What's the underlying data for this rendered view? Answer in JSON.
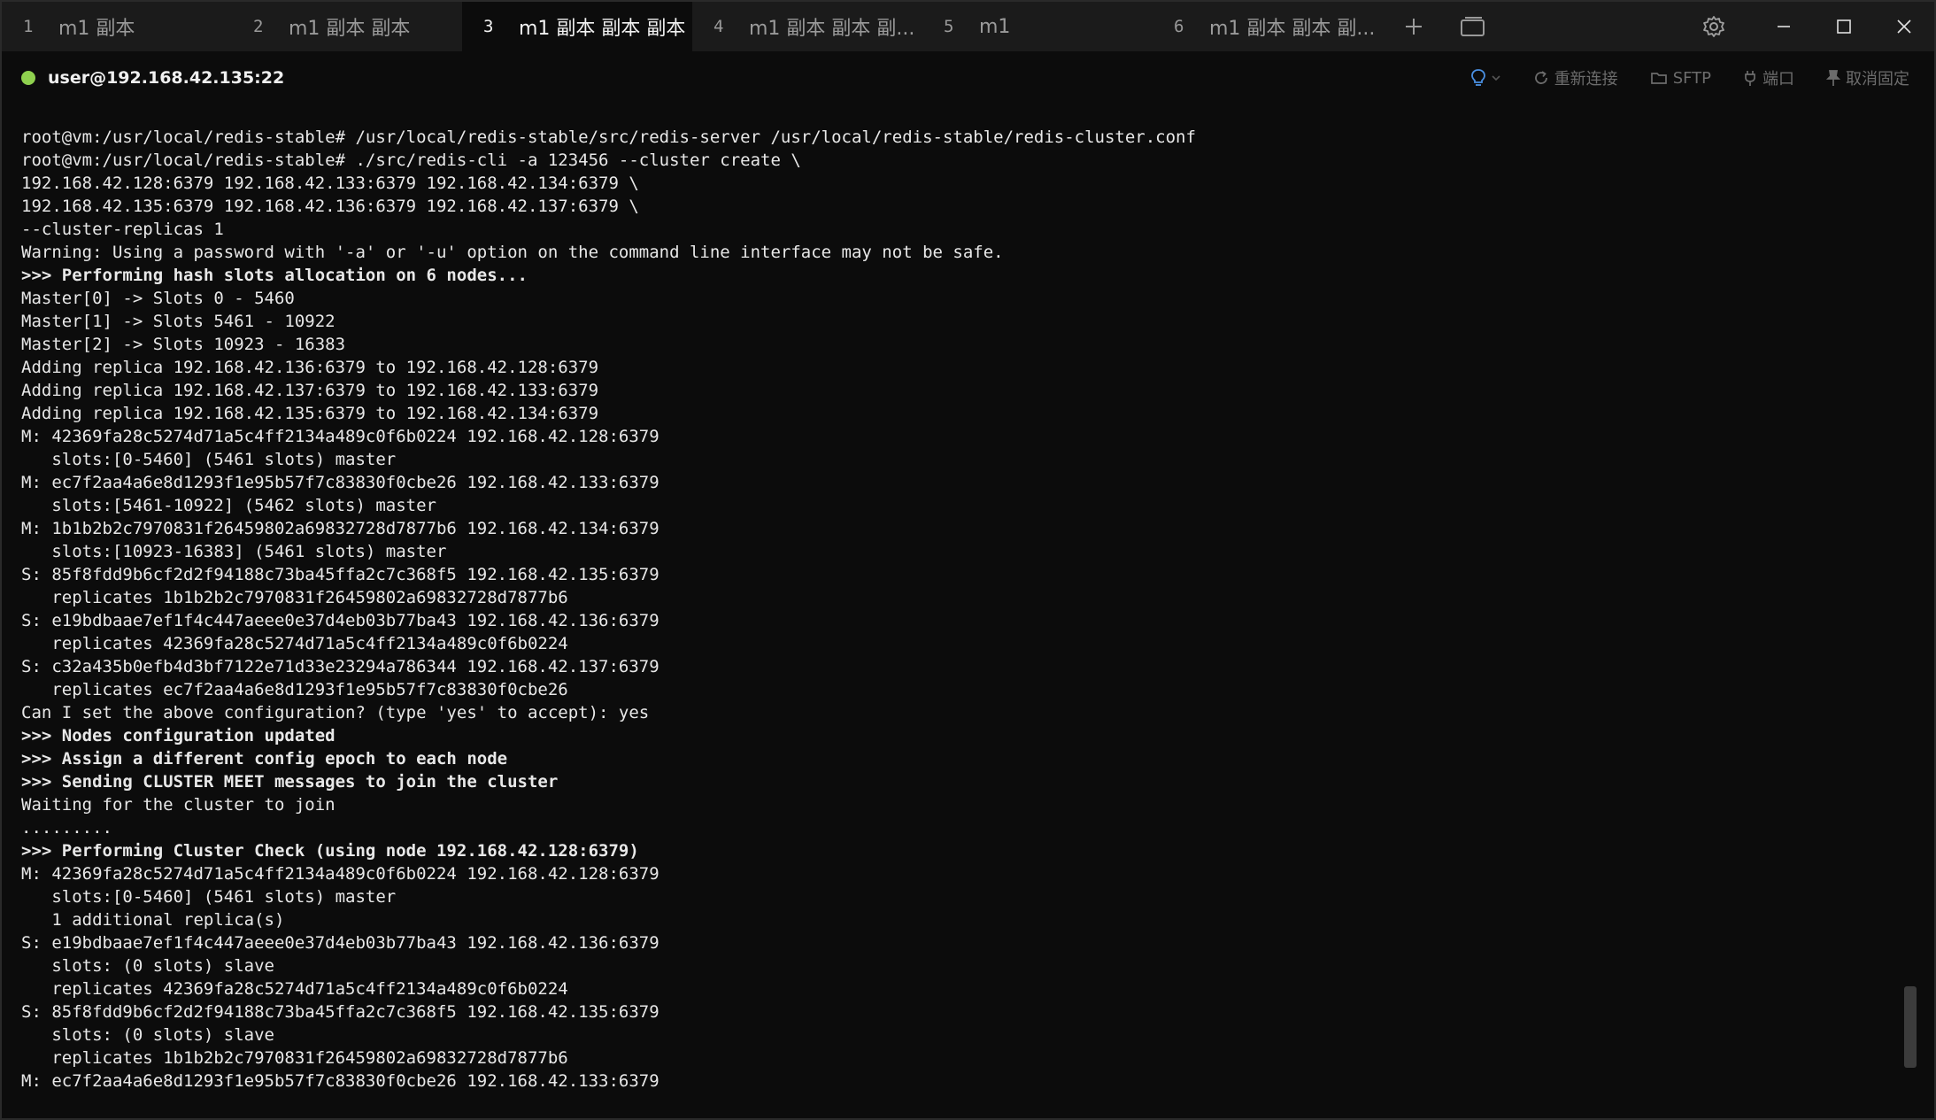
{
  "tabs": [
    {
      "num": "1",
      "title": "m1 副本"
    },
    {
      "num": "2",
      "title": "m1 副本 副本"
    },
    {
      "num": "3",
      "title": "m1 副本 副本 副本"
    },
    {
      "num": "4",
      "title": "m1 副本 副本 副..."
    },
    {
      "num": "5",
      "title": "m1"
    },
    {
      "num": "6",
      "title": "m1 副本 副本 副..."
    }
  ],
  "session": {
    "title": "user@192.168.42.135:22",
    "status_color": "#8fd14f",
    "actions": {
      "reconnect": "重新连接",
      "sftp": "SFTP",
      "port": "端口",
      "unpin": "取消固定"
    }
  },
  "terminal": {
    "lines": [
      {
        "text": "root@vm:/usr/local/redis-stable# /usr/local/redis-stable/src/redis-server /usr/local/redis-stable/redis-cluster.conf",
        "bold": false
      },
      {
        "text": "root@vm:/usr/local/redis-stable# ./src/redis-cli -a 123456 --cluster create \\",
        "bold": false
      },
      {
        "text": "192.168.42.128:6379 192.168.42.133:6379 192.168.42.134:6379 \\",
        "bold": false
      },
      {
        "text": "192.168.42.135:6379 192.168.42.136:6379 192.168.42.137:6379 \\",
        "bold": false
      },
      {
        "text": "--cluster-replicas 1",
        "bold": false
      },
      {
        "text": "Warning: Using a password with '-a' or '-u' option on the command line interface may not be safe.",
        "bold": false
      },
      {
        "text": ">>> Performing hash slots allocation on 6 nodes...",
        "bold": true
      },
      {
        "text": "Master[0] -> Slots 0 - 5460",
        "bold": false
      },
      {
        "text": "Master[1] -> Slots 5461 - 10922",
        "bold": false
      },
      {
        "text": "Master[2] -> Slots 10923 - 16383",
        "bold": false
      },
      {
        "text": "Adding replica 192.168.42.136:6379 to 192.168.42.128:6379",
        "bold": false
      },
      {
        "text": "Adding replica 192.168.42.137:6379 to 192.168.42.133:6379",
        "bold": false
      },
      {
        "text": "Adding replica 192.168.42.135:6379 to 192.168.42.134:6379",
        "bold": false
      },
      {
        "text": "M: 42369fa28c5274d71a5c4ff2134a489c0f6b0224 192.168.42.128:6379",
        "bold": false
      },
      {
        "text": "   slots:[0-5460] (5461 slots) master",
        "bold": false
      },
      {
        "text": "M: ec7f2aa4a6e8d1293f1e95b57f7c83830f0cbe26 192.168.42.133:6379",
        "bold": false
      },
      {
        "text": "   slots:[5461-10922] (5462 slots) master",
        "bold": false
      },
      {
        "text": "M: 1b1b2b2c7970831f26459802a69832728d7877b6 192.168.42.134:6379",
        "bold": false
      },
      {
        "text": "   slots:[10923-16383] (5461 slots) master",
        "bold": false
      },
      {
        "text": "S: 85f8fdd9b6cf2d2f94188c73ba45ffa2c7c368f5 192.168.42.135:6379",
        "bold": false
      },
      {
        "text": "   replicates 1b1b2b2c7970831f26459802a69832728d7877b6",
        "bold": false
      },
      {
        "text": "S: e19bdbaae7ef1f4c447aeee0e37d4eb03b77ba43 192.168.42.136:6379",
        "bold": false
      },
      {
        "text": "   replicates 42369fa28c5274d71a5c4ff2134a489c0f6b0224",
        "bold": false
      },
      {
        "text": "S: c32a435b0efb4d3bf7122e71d33e23294a786344 192.168.42.137:6379",
        "bold": false
      },
      {
        "text": "   replicates ec7f2aa4a6e8d1293f1e95b57f7c83830f0cbe26",
        "bold": false
      },
      {
        "text": "Can I set the above configuration? (type 'yes' to accept): yes",
        "bold": false
      },
      {
        "text": ">>> Nodes configuration updated",
        "bold": true
      },
      {
        "text": ">>> Assign a different config epoch to each node",
        "bold": true
      },
      {
        "text": ">>> Sending CLUSTER MEET messages to join the cluster",
        "bold": true
      },
      {
        "text": "Waiting for the cluster to join",
        "bold": false
      },
      {
        "text": ".........",
        "bold": false
      },
      {
        "text": ">>> Performing Cluster Check (using node 192.168.42.128:6379)",
        "bold": true
      },
      {
        "text": "M: 42369fa28c5274d71a5c4ff2134a489c0f6b0224 192.168.42.128:6379",
        "bold": false
      },
      {
        "text": "   slots:[0-5460] (5461 slots) master",
        "bold": false
      },
      {
        "text": "   1 additional replica(s)",
        "bold": false
      },
      {
        "text": "S: e19bdbaae7ef1f4c447aeee0e37d4eb03b77ba43 192.168.42.136:6379",
        "bold": false
      },
      {
        "text": "   slots: (0 slots) slave",
        "bold": false
      },
      {
        "text": "   replicates 42369fa28c5274d71a5c4ff2134a489c0f6b0224",
        "bold": false
      },
      {
        "text": "S: 85f8fdd9b6cf2d2f94188c73ba45ffa2c7c368f5 192.168.42.135:6379",
        "bold": false
      },
      {
        "text": "   slots: (0 slots) slave",
        "bold": false
      },
      {
        "text": "   replicates 1b1b2b2c7970831f26459802a69832728d7877b6",
        "bold": false
      },
      {
        "text": "M: ec7f2aa4a6e8d1293f1e95b57f7c83830f0cbe26 192.168.42.133:6379",
        "bold": false
      }
    ]
  }
}
